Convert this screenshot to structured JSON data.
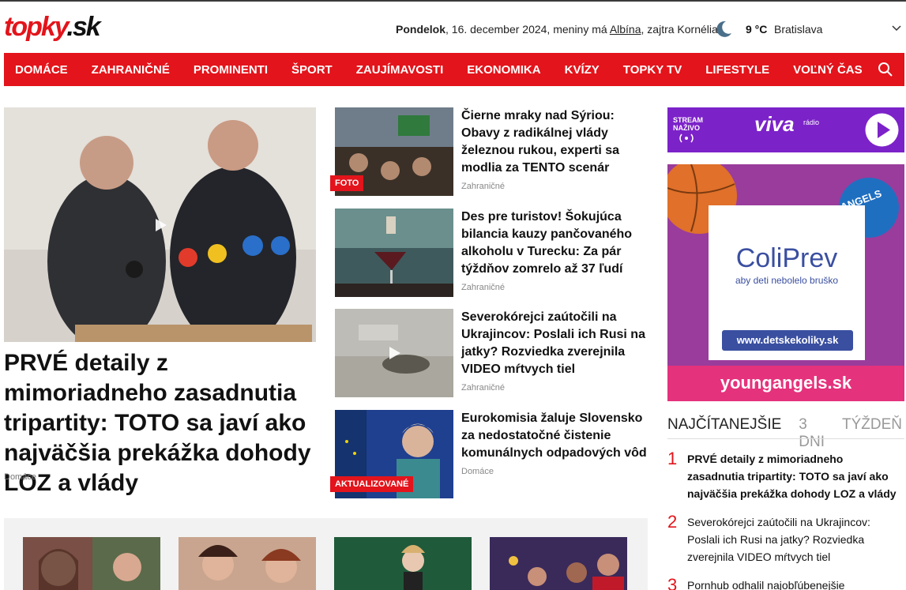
{
  "header": {
    "logo_part1": "topky",
    "logo_part2": ".sk",
    "day": "Pondelok",
    "date_text": ", 16. december 2024, meniny má ",
    "nameday": "Albína",
    "tomorrow": ", zajtra Kornélia",
    "temperature": "9 °C",
    "city": "Bratislava"
  },
  "nav": {
    "items": [
      "DOMÁCE",
      "ZAHRANIČNÉ",
      "PROMINENTI",
      "ŠPORT",
      "ZAUJÍMAVOSTI",
      "EKONOMIKA",
      "KVÍZY",
      "TOPKY TV",
      "LIFESTYLE",
      "VOĽNÝ ČAS"
    ]
  },
  "hero": {
    "title": "PRVÉ detaily z mimoriadneho zasadnutia tripartity: TOTO sa javí ako najväčšia prekážka dohody LOZ a vlády",
    "category": "Domáce"
  },
  "articles": [
    {
      "title": "Čierne mraky nad Sýriou: Obavy z radikálnej vlády železnou rukou, experti sa modlia za TENTO scenár",
      "category": "Zahraničné",
      "badge": "FOTO"
    },
    {
      "title": "Des pre turistov! Šokujúca bilancia kauzy pančovaného alkoholu v Turecku: Za pár týždňov zomrelo až 37 ľudí",
      "category": "Zahraničné",
      "badge": ""
    },
    {
      "title": "Severokórejci zaútočili na Ukrajincov: Poslali ich Rusi na jatky? Rozviedka zverejnila VIDEO mŕtvych tiel",
      "category": "Zahraničné",
      "badge": ""
    },
    {
      "title": "Eurokomisia žaluje Slovensko za nedostatočné čistenie komunálnych odpadových vôd",
      "category": "Domáce",
      "badge": "AKTUALIZOVANÉ"
    }
  ],
  "stream": {
    "line1": "STREAM",
    "line2": "NAŽIVO",
    "brand": "viva",
    "sub": "rádio"
  },
  "ad": {
    "brand": "ColiPrev",
    "tagline": "aby deti nebolelo bruško",
    "url": "www.detskekoliky.sk",
    "footer": "youngangels.sk",
    "corner": "ANGELS"
  },
  "tabs": {
    "t1": "NAJČÍTANEJŠIE",
    "t2": "3 DNI",
    "t3": "TÝŽDEŇ"
  },
  "most_read": [
    {
      "n": "1",
      "text": "PRVÉ detaily z mimoriadneho zasadnutia tripartity: TOTO sa javí ako najväčšia prekážka dohody LOZ a vlády",
      "bold": true
    },
    {
      "n": "2",
      "text": "Severokórejci zaútočili na Ukrajincov: Poslali ich Rusi na jatky? Rozviedka zverejnila VIDEO mŕtvych tiel",
      "bold": false
    },
    {
      "n": "3",
      "text": "Pornhub odhalil najobľúbenejšie",
      "bold": false
    }
  ],
  "colors": {
    "brand_red": "#e3141b",
    "stream_purple": "#7c22c9"
  }
}
